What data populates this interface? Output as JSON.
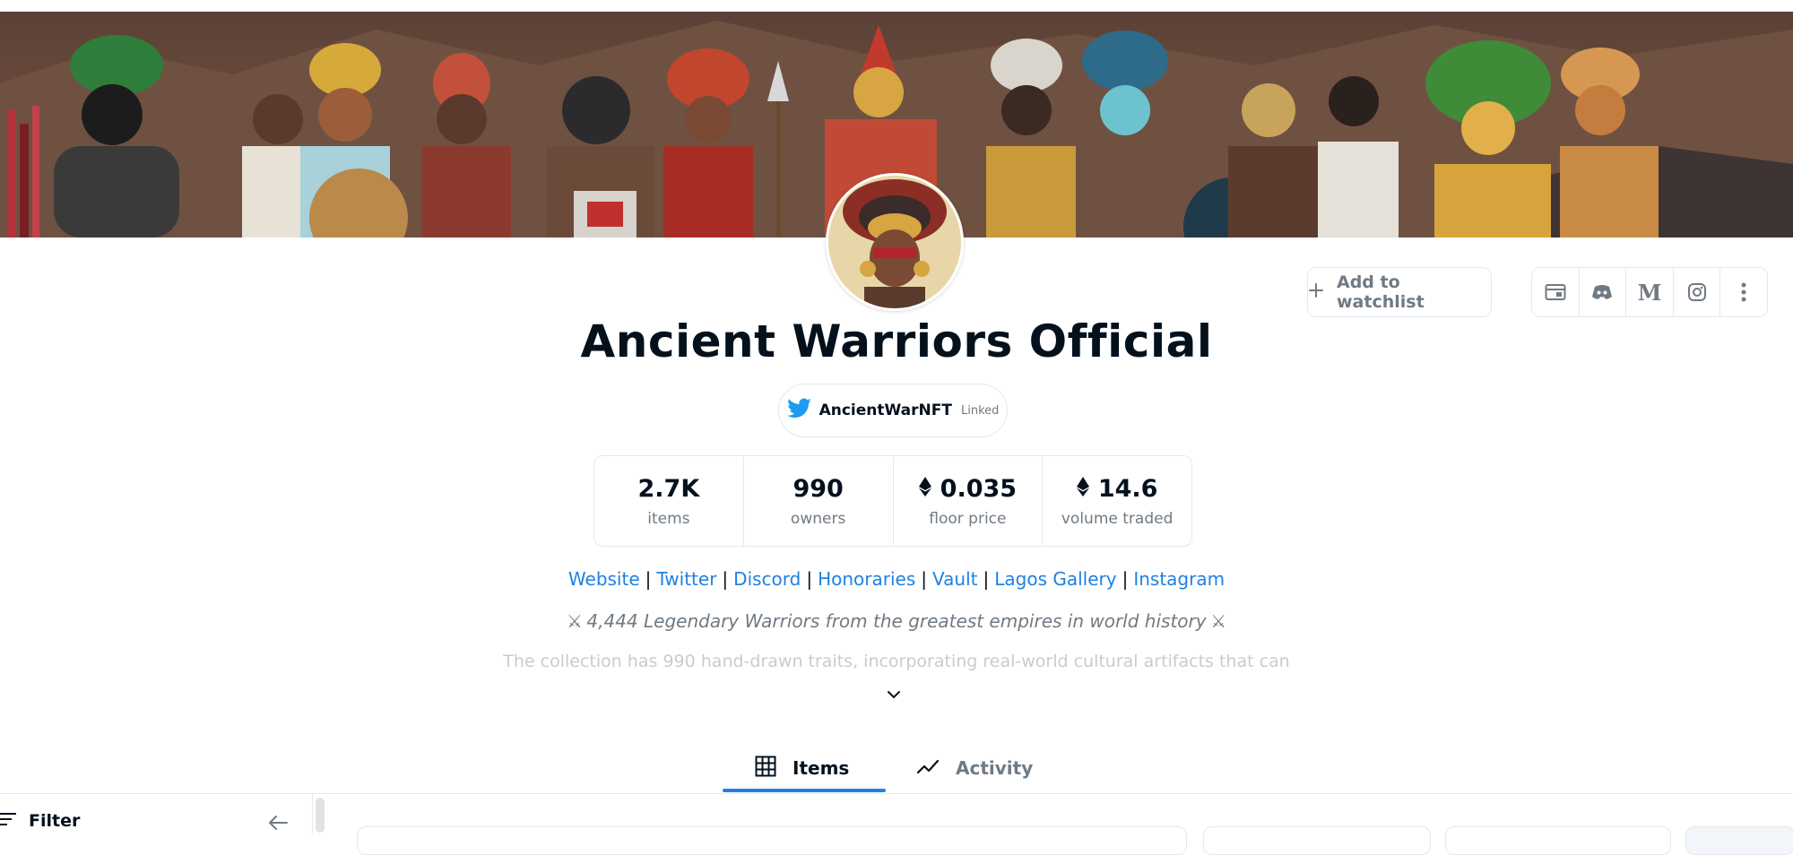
{
  "collection": {
    "title": "Ancient Warriors Official",
    "twitter_handle": "AncientWarNFT",
    "twitter_status": "Linked"
  },
  "toolbar": {
    "watchlist_label": "Add to watchlist",
    "icons": [
      "website-icon",
      "discord-icon",
      "medium-icon",
      "instagram-icon",
      "more-icon"
    ]
  },
  "stats": [
    {
      "value": "2.7K",
      "label": "items",
      "eth": false
    },
    {
      "value": "990",
      "label": "owners",
      "eth": false
    },
    {
      "value": "0.035",
      "label": "floor price",
      "eth": true
    },
    {
      "value": "14.6",
      "label": "volume traded",
      "eth": true
    }
  ],
  "links": [
    "Website",
    "Twitter",
    "Discord",
    "Honoraries",
    "Vault",
    "Lagos Gallery",
    "Instagram"
  ],
  "link_separator": "|",
  "tagline": "⚔ 4,444 Legendary Warriors from the greatest empires in world history ⚔",
  "description": "The collection has 990 hand-drawn traits, incorporating real-world cultural artifacts that can",
  "tabs": [
    {
      "label": "Items",
      "icon": "grid-icon",
      "active": true
    },
    {
      "label": "Activity",
      "icon": "chart-line-icon",
      "active": false
    }
  ],
  "filter": {
    "label": "Filter"
  },
  "colors": {
    "accent": "#2081e2",
    "text": "#04111d",
    "muted": "#707a83",
    "border": "#e5e8eb"
  }
}
